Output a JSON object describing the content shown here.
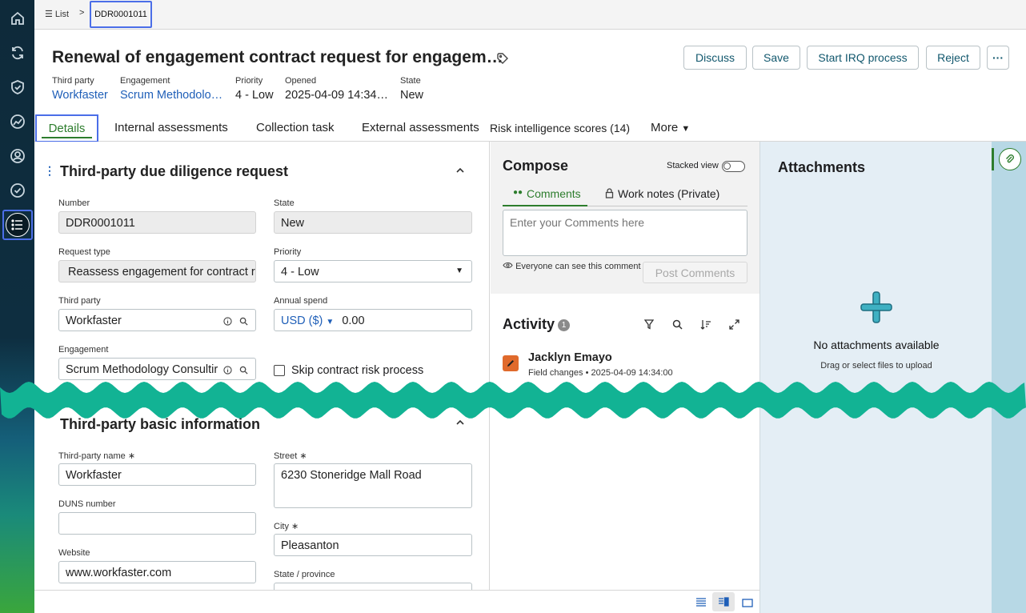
{
  "breadcrumb": {
    "list_label": "List",
    "separator": ">",
    "current": "DDR0001011"
  },
  "header": {
    "title": "Renewal of engagement contract request for engagem…",
    "buttons": {
      "discuss": "Discuss",
      "save": "Save",
      "start_irq": "Start IRQ process",
      "reject": "Reject",
      "more": "···"
    },
    "meta": [
      {
        "label": "Third party",
        "value": "Workfaster"
      },
      {
        "label": "Engagement",
        "value": "Scrum Methodolo…"
      },
      {
        "label": "Priority",
        "value": "4 - Low"
      },
      {
        "label": "Opened",
        "value": "2025-04-09 14:34…"
      },
      {
        "label": "State",
        "value": "New"
      }
    ]
  },
  "tabs": {
    "details": "Details",
    "internal": "Internal assessments",
    "collection": "Collection task",
    "external": "External assessments",
    "risk": "Risk intelligence scores (14)",
    "more": "More"
  },
  "form": {
    "section1": "Third-party due diligence request",
    "number_label": "Number",
    "number_value": "DDR0001011",
    "state_label": "State",
    "state_value": "New",
    "request_type_label": "Request type",
    "request_type_value": "Reassess engagement for contract r",
    "priority_label": "Priority",
    "priority_value": "4 - Low",
    "third_party_label": "Third party",
    "third_party_value": "Workfaster",
    "annual_spend_label": "Annual spend",
    "currency": "USD ($)",
    "spend_value": "0.00",
    "engagement_label": "Engagement",
    "engagement_value": "Scrum Methodology Consultir",
    "skip_label": "Skip contract risk process",
    "section2": "Third-party basic information",
    "tp_name_label": "Third-party name",
    "tp_name_value": "Workfaster",
    "street_label": "Street",
    "street_value": "6230 Stoneridge Mall Road",
    "duns_label": "DUNS number",
    "duns_value": "",
    "city_label": "City",
    "city_value": "Pleasanton",
    "website_label": "Website",
    "website_value": "www.workfaster.com",
    "state_prov_label": "State / province",
    "required_mark": "∗"
  },
  "compose": {
    "title": "Compose",
    "stacked_view": "Stacked view",
    "tab_comments": "Comments",
    "tab_worknotes": "Work notes (Private)",
    "placeholder": "Enter your Comments here",
    "visibility": "Everyone can see this comment",
    "post": "Post Comments"
  },
  "activity": {
    "title": "Activity",
    "count": "1",
    "user": "Jacklyn Emayo",
    "type": "Field changes",
    "bullet": "•",
    "time": "2025-04-09 14:34:00"
  },
  "attachments": {
    "title": "Attachments",
    "empty": "No attachments available",
    "hint": "Drag or select files to upload"
  },
  "colors": {
    "accent": "#11576d",
    "link": "#1f5fb8",
    "active_tab": "#2d7d2d",
    "highlight": "#4b6ee8",
    "wave": "#12b394"
  }
}
